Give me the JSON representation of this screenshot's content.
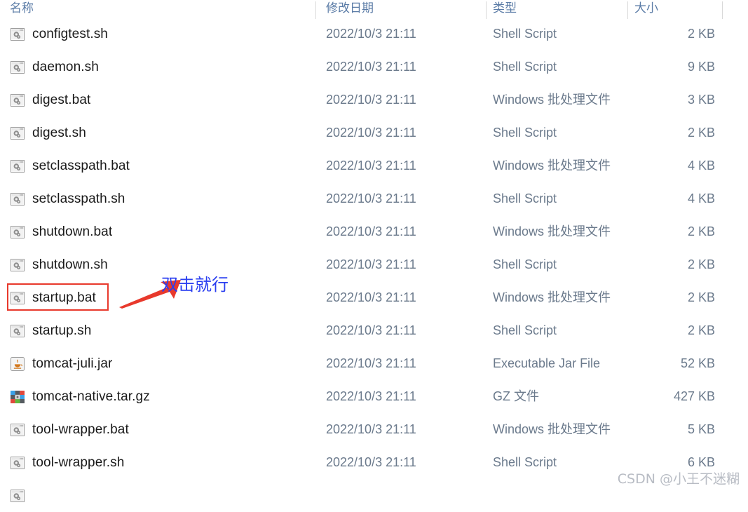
{
  "columns": {
    "name": "名称",
    "modified": "修改日期",
    "type": "类型",
    "size": "大小"
  },
  "files": [
    {
      "name": "configtest.sh",
      "icon": "shell-script-icon",
      "modified": "2022/10/3 21:11",
      "type": "Shell Script",
      "size": "2 KB"
    },
    {
      "name": "daemon.sh",
      "icon": "shell-script-icon",
      "modified": "2022/10/3 21:11",
      "type": "Shell Script",
      "size": "9 KB"
    },
    {
      "name": "digest.bat",
      "icon": "shell-script-icon",
      "modified": "2022/10/3 21:11",
      "type": "Windows 批处理文件",
      "size": "3 KB"
    },
    {
      "name": "digest.sh",
      "icon": "shell-script-icon",
      "modified": "2022/10/3 21:11",
      "type": "Shell Script",
      "size": "2 KB"
    },
    {
      "name": "setclasspath.bat",
      "icon": "shell-script-icon",
      "modified": "2022/10/3 21:11",
      "type": "Windows 批处理文件",
      "size": "4 KB"
    },
    {
      "name": "setclasspath.sh",
      "icon": "shell-script-icon",
      "modified": "2022/10/3 21:11",
      "type": "Shell Script",
      "size": "4 KB"
    },
    {
      "name": "shutdown.bat",
      "icon": "shell-script-icon",
      "modified": "2022/10/3 21:11",
      "type": "Windows 批处理文件",
      "size": "2 KB"
    },
    {
      "name": "shutdown.sh",
      "icon": "shell-script-icon",
      "modified": "2022/10/3 21:11",
      "type": "Shell Script",
      "size": "2 KB"
    },
    {
      "name": "startup.bat",
      "icon": "shell-script-icon",
      "modified": "2022/10/3 21:11",
      "type": "Windows 批处理文件",
      "size": "2 KB"
    },
    {
      "name": "startup.sh",
      "icon": "shell-script-icon",
      "modified": "2022/10/3 21:11",
      "type": "Shell Script",
      "size": "2 KB"
    },
    {
      "name": "tomcat-juli.jar",
      "icon": "java-jar-icon",
      "modified": "2022/10/3 21:11",
      "type": "Executable Jar File",
      "size": "52 KB"
    },
    {
      "name": "tomcat-native.tar.gz",
      "icon": "archive-icon",
      "modified": "2022/10/3 21:11",
      "type": "GZ 文件",
      "size": "427 KB"
    },
    {
      "name": "tool-wrapper.bat",
      "icon": "shell-script-icon",
      "modified": "2022/10/3 21:11",
      "type": "Windows 批处理文件",
      "size": "5 KB"
    },
    {
      "name": "tool-wrapper.sh",
      "icon": "shell-script-icon",
      "modified": "2022/10/3 21:11",
      "type": "Shell Script",
      "size": "6 KB"
    }
  ],
  "annotation": {
    "text": "双击就行",
    "target_file": "startup.bat",
    "highlight_color": "#e8392c",
    "arrow_color": "#e8392c",
    "text_color": "#2b3ff0"
  },
  "watermark": {
    "text": "CSDN @小王不迷糊"
  }
}
